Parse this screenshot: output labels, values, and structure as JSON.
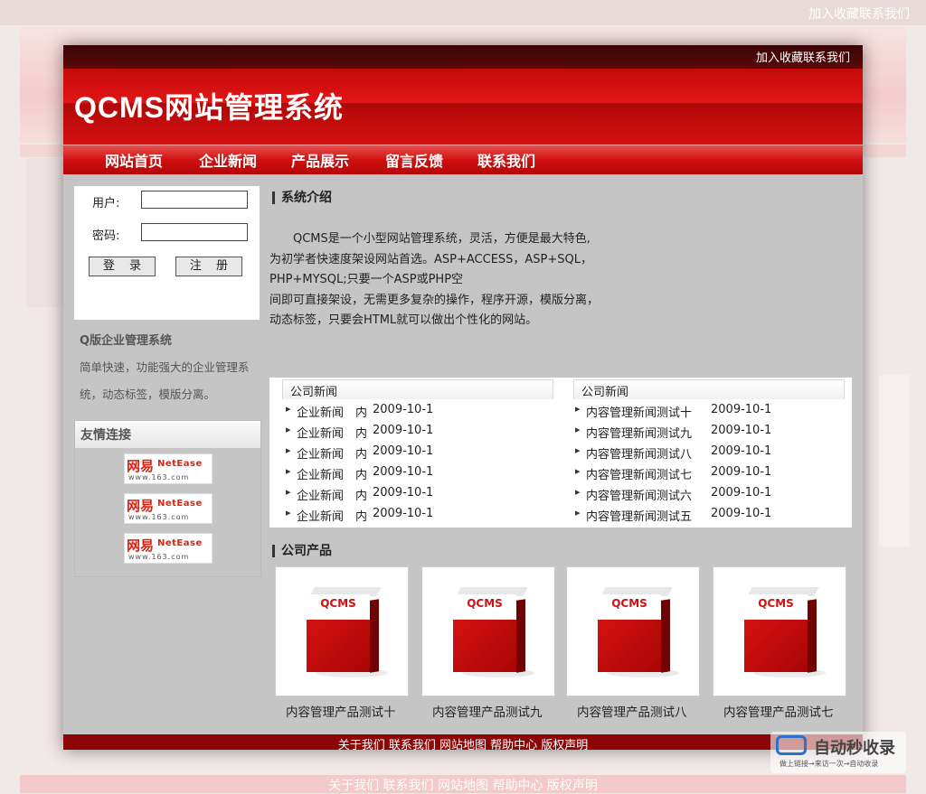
{
  "top_links": "加入收藏联系我们",
  "site_title": "QCMS网站管理系统",
  "nav": [
    "网站首页",
    "企业新闻",
    "产品展示",
    "留言反馈",
    "联系我们"
  ],
  "login": {
    "user_label": "用户:",
    "pass_label": "密码:",
    "login_button": "登 录",
    "register_button": "注 册"
  },
  "intro_box": {
    "title": "Q版企业管理系统",
    "text": "简单快速，功能强大的企业管理系统，动态标签，模版分离。"
  },
  "links": {
    "title": "友情连接",
    "items": [
      {
        "cn": "网易",
        "en": "NetEase",
        "url": "www.163.com"
      },
      {
        "cn": "网易",
        "en": "NetEase",
        "url": "www.163.com"
      },
      {
        "cn": "网易",
        "en": "NetEase",
        "url": "www.163.com"
      }
    ]
  },
  "system_intro": {
    "title": "系统介绍",
    "lines": [
      "　　QCMS是一个小型网站管理系统，灵活，方便是最大特色,",
      "为初学者快速度架设网站首选。ASP+ACCESS，ASP+SQL，",
      "PHP+MYSQL;只要一个ASP或PHP空",
      "间即可直接架设，无需更多复杂的操作，程序开源，模版分离，",
      "动态标签，只要会HTML就可以做出个性化的网站。"
    ]
  },
  "news_left": {
    "tab": "公司新闻",
    "items": [
      {
        "title": "企业新闻　内",
        "date": "2009-10-1"
      },
      {
        "title": "企业新闻　内",
        "date": "2009-10-1"
      },
      {
        "title": "企业新闻　内",
        "date": "2009-10-1"
      },
      {
        "title": "企业新闻　内",
        "date": "2009-10-1"
      },
      {
        "title": "企业新闻　内",
        "date": "2009-10-1"
      },
      {
        "title": "企业新闻　内",
        "date": "2009-10-1"
      }
    ]
  },
  "news_right": {
    "tab": "公司新闻",
    "items": [
      {
        "title": "内容管理新闻测试十",
        "date": "2009-10-1"
      },
      {
        "title": "内容管理新闻测试九",
        "date": "2009-10-1"
      },
      {
        "title": "内容管理新闻测试八",
        "date": "2009-10-1"
      },
      {
        "title": "内容管理新闻测试七",
        "date": "2009-10-1"
      },
      {
        "title": "内容管理新闻测试六",
        "date": "2009-10-1"
      },
      {
        "title": "内容管理新闻测试五",
        "date": "2009-10-1"
      }
    ]
  },
  "products": {
    "title": "公司产品",
    "box_label": "QCMS",
    "items": [
      "内容管理产品测试十",
      "内容管理产品测试九",
      "内容管理产品测试八",
      "内容管理产品测试七"
    ]
  },
  "footer": "关于我们 联系我们 网站地图 帮助中心 版权声明",
  "watermark": {
    "brand": "自动秒收录",
    "sub": "做上链接→来访一次→自动收录"
  },
  "colors": {
    "brand_red": "#d11010",
    "dark_red": "#5a0808",
    "footer_red": "#8c0606"
  }
}
